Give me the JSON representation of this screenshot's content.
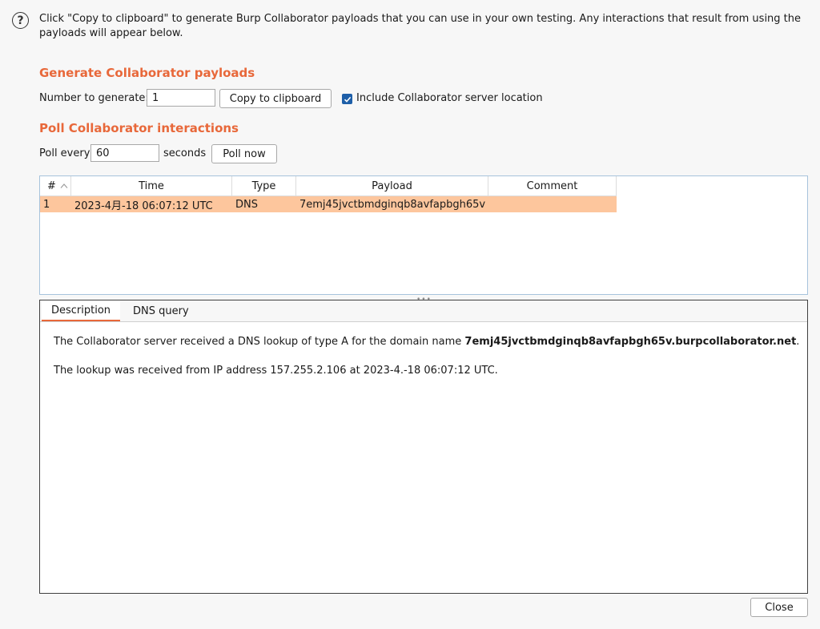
{
  "intro": {
    "text": "Click \"Copy to clipboard\" to generate Burp Collaborator payloads that you can use in your own testing. Any interactions that result from using the payloads will appear below."
  },
  "generate": {
    "title": "Generate Collaborator payloads",
    "number_label": "Number to generate:",
    "number_value": "1",
    "copy_button": "Copy to clipboard",
    "include_location_label": "Include Collaborator server location",
    "include_location_checked": true
  },
  "poll": {
    "title": "Poll Collaborator interactions",
    "poll_every_label": "Poll every",
    "poll_value": "60",
    "seconds_label": "seconds",
    "poll_now_button": "Poll now"
  },
  "table": {
    "columns": [
      "#",
      "Time",
      "Type",
      "Payload",
      "Comment"
    ],
    "sort_column": "#",
    "rows": [
      {
        "num": "1",
        "time": "2023-4月-18 06:07:12 UTC",
        "type": "DNS",
        "payload": "7emj45jvctbmdginqb8avfapbgh65v",
        "comment": ""
      }
    ]
  },
  "tabs": [
    {
      "label": "Description",
      "active": true
    },
    {
      "label": "DNS query",
      "active": false
    }
  ],
  "description": {
    "line1_prefix": "The Collaborator server received a DNS lookup of type A for the domain name ",
    "line1_domain": "7emj45jvctbmdginqb8avfapbgh65v.burpcollaborator.net",
    "line1_suffix": ".",
    "line2": "The lookup was received from IP address 157.255.2.106 at 2023-4.-18 06:07:12 UTC."
  },
  "footer": {
    "close_button": "Close"
  },
  "colors": {
    "accent": "#e8683a",
    "row_highlight": "#fdc69d",
    "checkbox": "#1e5fa8"
  },
  "icons": {
    "help": "help-circle-icon",
    "sort": "sort-ascending-icon",
    "check": "checkmark-icon"
  }
}
